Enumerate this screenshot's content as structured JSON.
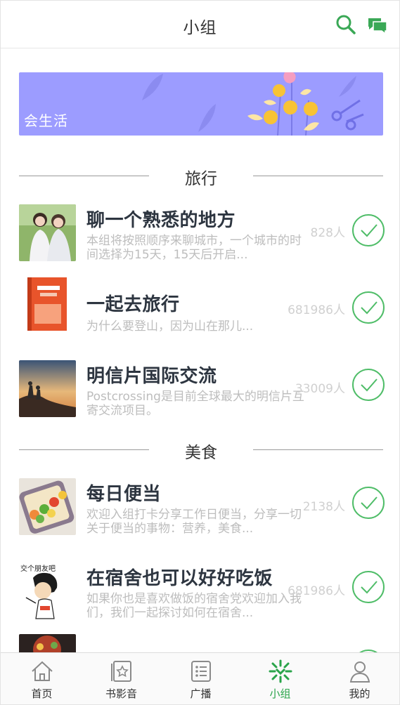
{
  "header": {
    "title": "小组",
    "search_icon": "search-icon",
    "chat_icon": "chat-icon"
  },
  "banner": {
    "text": "会生活",
    "color": "#9c9cff"
  },
  "sections": [
    {
      "title": "旅行",
      "groups": [
        {
          "name": "聊一个熟悉的地方",
          "desc": "本组将按照顺序来聊城市，一个城市的时间选择为15天，15天后开启...",
          "count": "828人"
        },
        {
          "name": "一起去旅行",
          "desc": "为什么要登山，因为山在那儿...",
          "count": "681986人"
        },
        {
          "name": "明信片国际交流",
          "desc": "Postcrossing是目前全球最大的明信片互寄交流项目。",
          "count": "33009人"
        }
      ]
    },
    {
      "title": "美食",
      "groups": [
        {
          "name": "每日便当",
          "desc": "欢迎入组打卡分享工作日便当，分享一切关于便当的事物：营养，美食...",
          "count": "2138人"
        },
        {
          "name": "在宿舍也可以好好吃饭",
          "desc": "如果你也是喜欢做饭的宿舍党欢迎加入我们，我们一起探讨如何在宿舍...",
          "count": "681986人",
          "thumb_caption": "交个朋友吧"
        }
      ]
    }
  ],
  "tabs": [
    {
      "label": "首页",
      "icon": "home-icon"
    },
    {
      "label": "书影音",
      "icon": "star-card-icon"
    },
    {
      "label": "广播",
      "icon": "broadcast-list-icon"
    },
    {
      "label": "小组",
      "icon": "group-icon",
      "active": true
    },
    {
      "label": "我的",
      "icon": "person-icon"
    }
  ],
  "colors": {
    "accent": "#4fbd68",
    "active_tab": "#2aa44a"
  }
}
